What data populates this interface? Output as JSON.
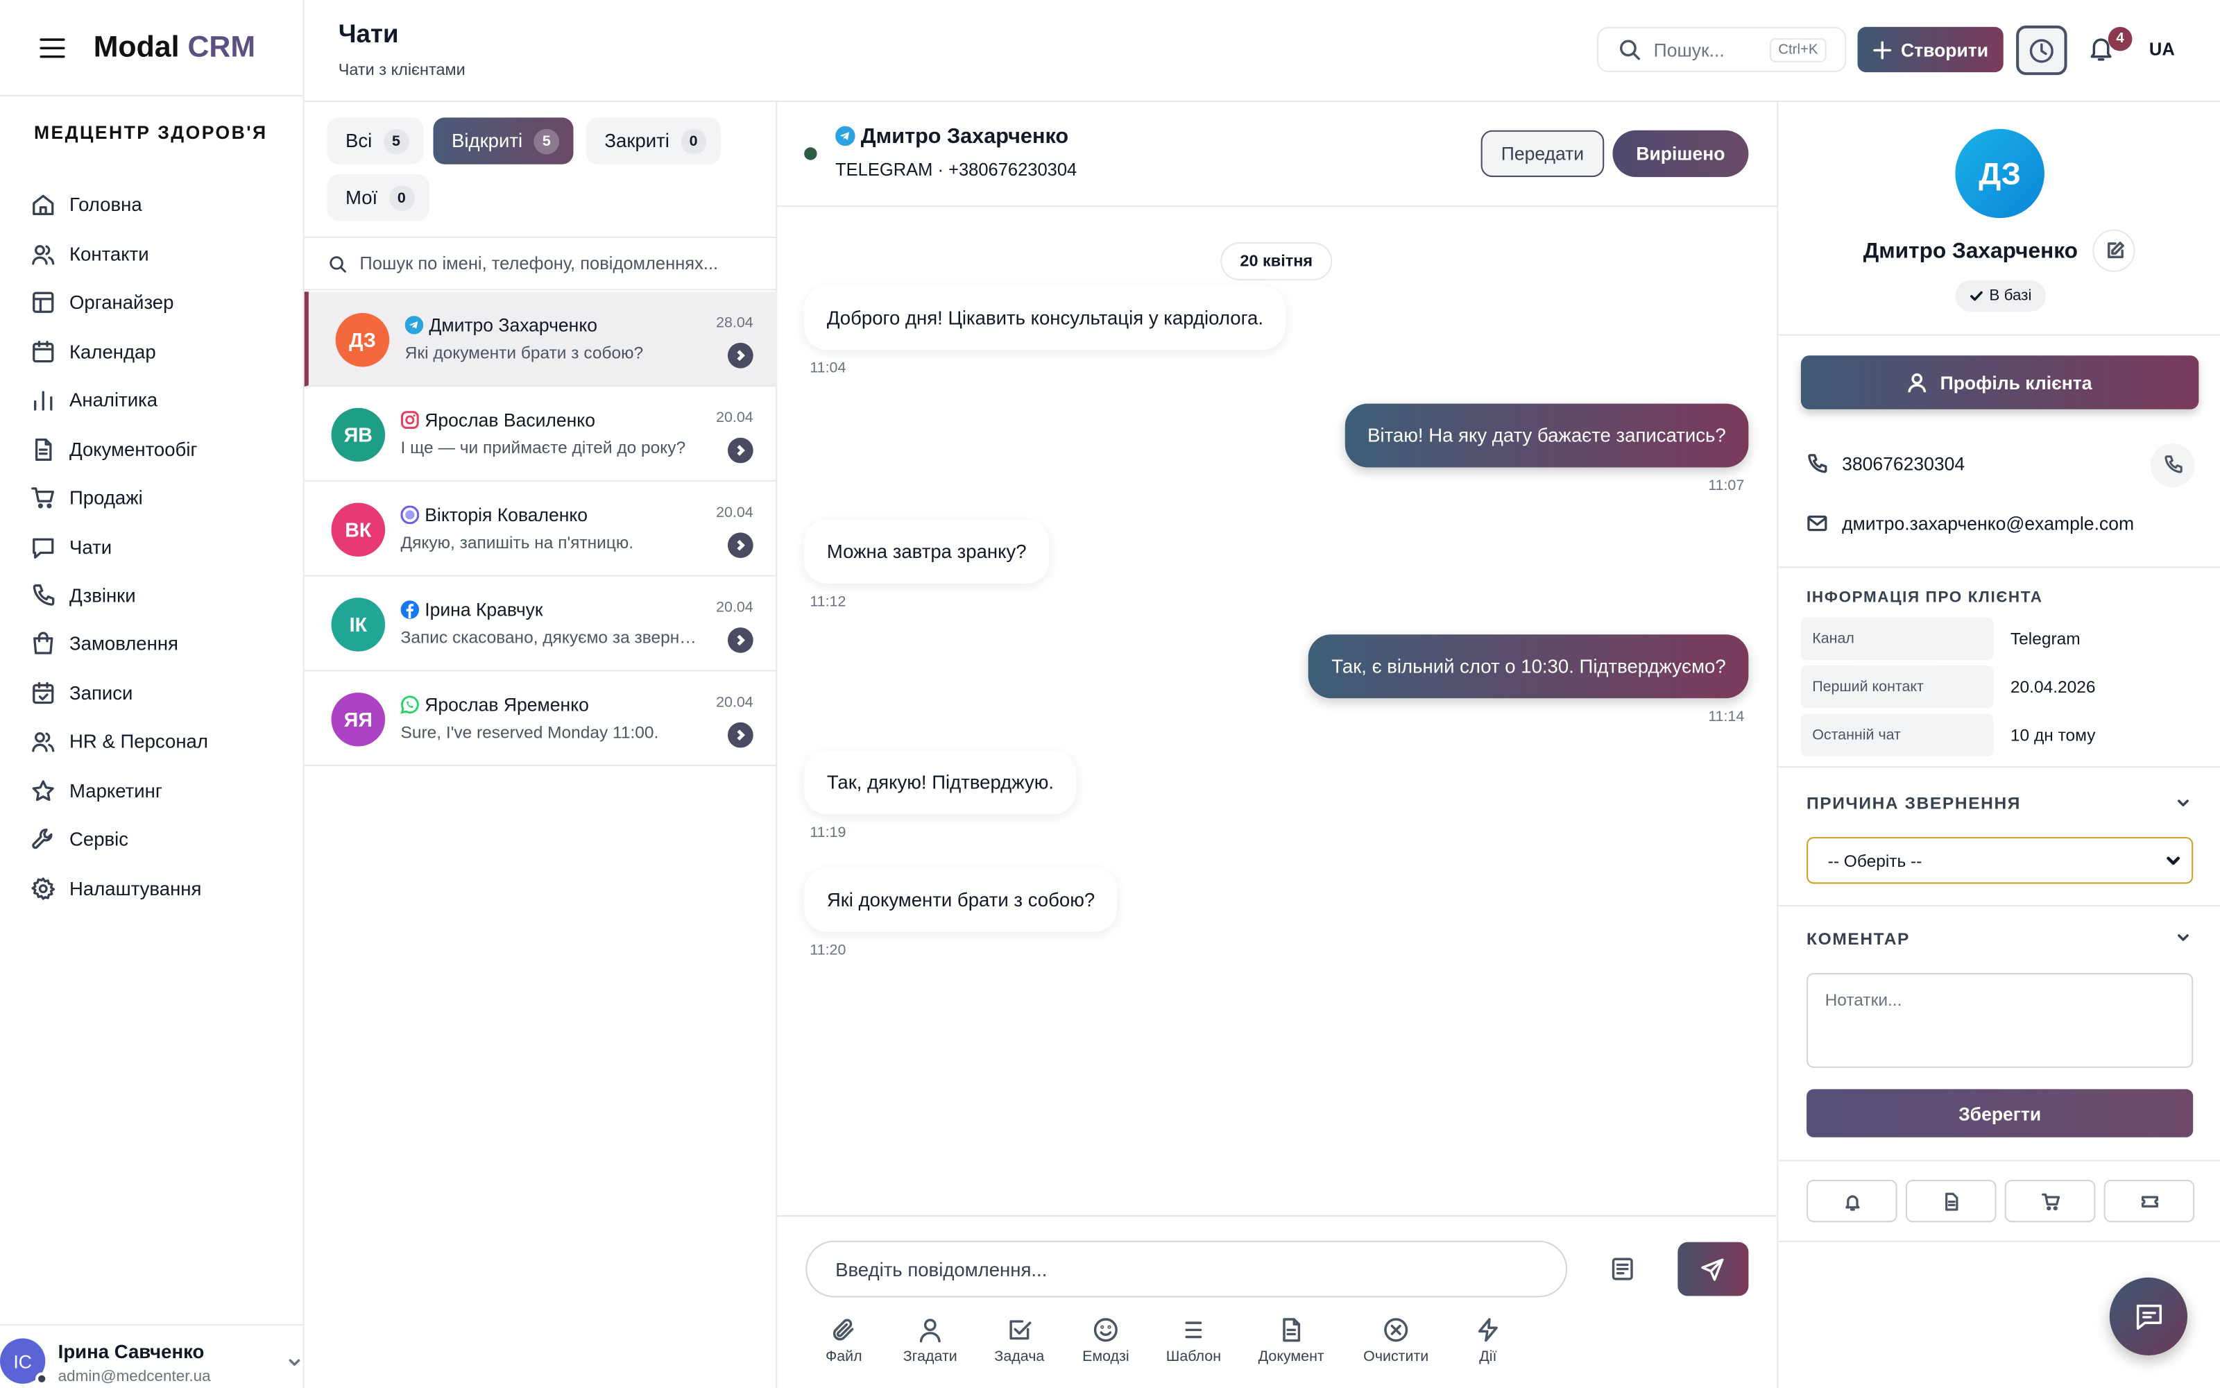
{
  "app": {
    "logo_main": "Modal",
    "logo_accent": "CRM",
    "organization": "МЕДЦЕНТР ЗДОРОВ'Я"
  },
  "nav": [
    {
      "label": "Головна",
      "icon": "home-icon"
    },
    {
      "label": "Контакти",
      "icon": "users-icon"
    },
    {
      "label": "Органайзер",
      "icon": "layout-icon"
    },
    {
      "label": "Календар",
      "icon": "calendar-icon"
    },
    {
      "label": "Аналітика",
      "icon": "bar-chart-icon"
    },
    {
      "label": "Документообіг",
      "icon": "document-icon"
    },
    {
      "label": "Продажі",
      "icon": "cart-icon"
    },
    {
      "label": "Чати",
      "icon": "chat-icon"
    },
    {
      "label": "Дзвінки",
      "icon": "phone-icon"
    },
    {
      "label": "Замовлення",
      "icon": "bag-icon"
    },
    {
      "label": "Записи",
      "icon": "calendar-check-icon"
    },
    {
      "label": "HR & Персонал",
      "icon": "team-icon"
    },
    {
      "label": "Маркетинг",
      "icon": "star-icon"
    },
    {
      "label": "Сервіс",
      "icon": "wrench-icon"
    },
    {
      "label": "Налаштування",
      "icon": "gear-icon"
    }
  ],
  "user": {
    "initials": "IC",
    "name": "Ірина Савченко",
    "email": "admin@medcenter.ua"
  },
  "header": {
    "title": "Чати",
    "subtitle": "Чати з клієнтами",
    "search_placeholder": "Пошук...",
    "search_shortcut": "Ctrl+K",
    "create_label": "Створити",
    "notifications_count": "4",
    "language": "UA"
  },
  "tabs": [
    {
      "label": "Всі",
      "count": "5",
      "active": false
    },
    {
      "label": "Відкриті",
      "count": "5",
      "active": true
    },
    {
      "label": "Закриті",
      "count": "0",
      "active": false
    },
    {
      "label": "Мої",
      "count": "0",
      "active": false
    }
  ],
  "list_search_placeholder": "Пошук по імені, телефону, повідомленнях...",
  "chats": [
    {
      "initials": "ДЗ",
      "name": "Дмитро Захарченко",
      "channel": "telegram",
      "preview": "Які документи брати з собою?",
      "date": "28.04",
      "avatar_color": "#f4683d",
      "selected": true
    },
    {
      "initials": "ЯВ",
      "name": "Ярослав Василенко",
      "channel": "instagram",
      "preview": "І ще — чи приймаєте дітей до року?",
      "date": "20.04",
      "avatar_color": "#1e9e87",
      "selected": false
    },
    {
      "initials": "ВК",
      "name": "Вікторія Коваленко",
      "channel": "viber",
      "preview": "Дякую, запишіть на п'ятницю.",
      "date": "20.04",
      "avatar_color": "#e73a74",
      "selected": false
    },
    {
      "initials": "ІК",
      "name": "Ірина Кравчук",
      "channel": "facebook",
      "preview": "Запис скасовано, дякуємо за звернення.",
      "date": "20.04",
      "avatar_color": "#21a594",
      "selected": false
    },
    {
      "initials": "ЯЯ",
      "name": "Ярослав Яременко",
      "channel": "whatsapp",
      "preview": "Sure, I've reserved Monday 11:00.",
      "date": "20.04",
      "avatar_color": "#ac42c4",
      "selected": false
    }
  ],
  "conversation": {
    "name": "Дмитро Захарченко",
    "meta": "TELEGRAM · +380676230304",
    "transfer_label": "Передати",
    "resolve_label": "Вирішено",
    "date_chip": "20 квітня",
    "messages": [
      {
        "dir": "in",
        "text": "Доброго дня! Цікавить консультація у кардіолога.",
        "time": "11:04"
      },
      {
        "dir": "out",
        "text": "Вітаю! На яку дату бажаєте записатись?",
        "time": "11:07"
      },
      {
        "dir": "in",
        "text": "Можна завтра зранку?",
        "time": "11:12"
      },
      {
        "dir": "out",
        "text": "Так, є вільний слот о 10:30. Підтверджуємо?",
        "time": "11:14"
      },
      {
        "dir": "in",
        "text": "Так, дякую! Підтверджую.",
        "time": "11:19"
      },
      {
        "dir": "in",
        "text": "Які документи брати з собою?",
        "time": "11:20"
      }
    ],
    "input_placeholder": "Введіть повідомлення...",
    "tools": [
      {
        "label": "Файл",
        "icon": "paperclip-icon"
      },
      {
        "label": "Згадати",
        "icon": "user-icon"
      },
      {
        "label": "Задача",
        "icon": "task-icon"
      },
      {
        "label": "Емодзі",
        "icon": "smile-icon"
      },
      {
        "label": "Шаблон",
        "icon": "list-icon"
      },
      {
        "label": "Документ",
        "icon": "document-icon"
      },
      {
        "label": "Очистити",
        "icon": "clear-icon"
      },
      {
        "label": "Дії",
        "icon": "bolt-icon"
      }
    ]
  },
  "client": {
    "initials": "ДЗ",
    "name": "Дмитро Захарченко",
    "badge": "В базі",
    "profile_button": "Профіль клієнта",
    "phone": "380676230304",
    "email": "дмитро.захарченко@example.com",
    "info_title": "ІНФОРМАЦІЯ ПРО КЛІЄНТА",
    "info": [
      {
        "label": "Канал",
        "value": "Telegram"
      },
      {
        "label": "Перший контакт",
        "value": "20.04.2026"
      },
      {
        "label": "Останній чат",
        "value": "10 дн тому"
      }
    ],
    "reason_title": "ПРИЧИНА ЗВЕРНЕННЯ",
    "reason_value": "-- Оберіть --",
    "comment_title": "КОМЕНТАР",
    "comment_placeholder": "Нотатки...",
    "save_label": "Зберегти",
    "quick_actions": [
      "bell-icon",
      "document-icon",
      "cart-icon",
      "ticket-icon"
    ]
  },
  "colors": {
    "accent": "#5b5080",
    "gradient_start": "#3f5873",
    "gradient_end": "#7b3a5c",
    "notification": "#8b3a4e"
  }
}
